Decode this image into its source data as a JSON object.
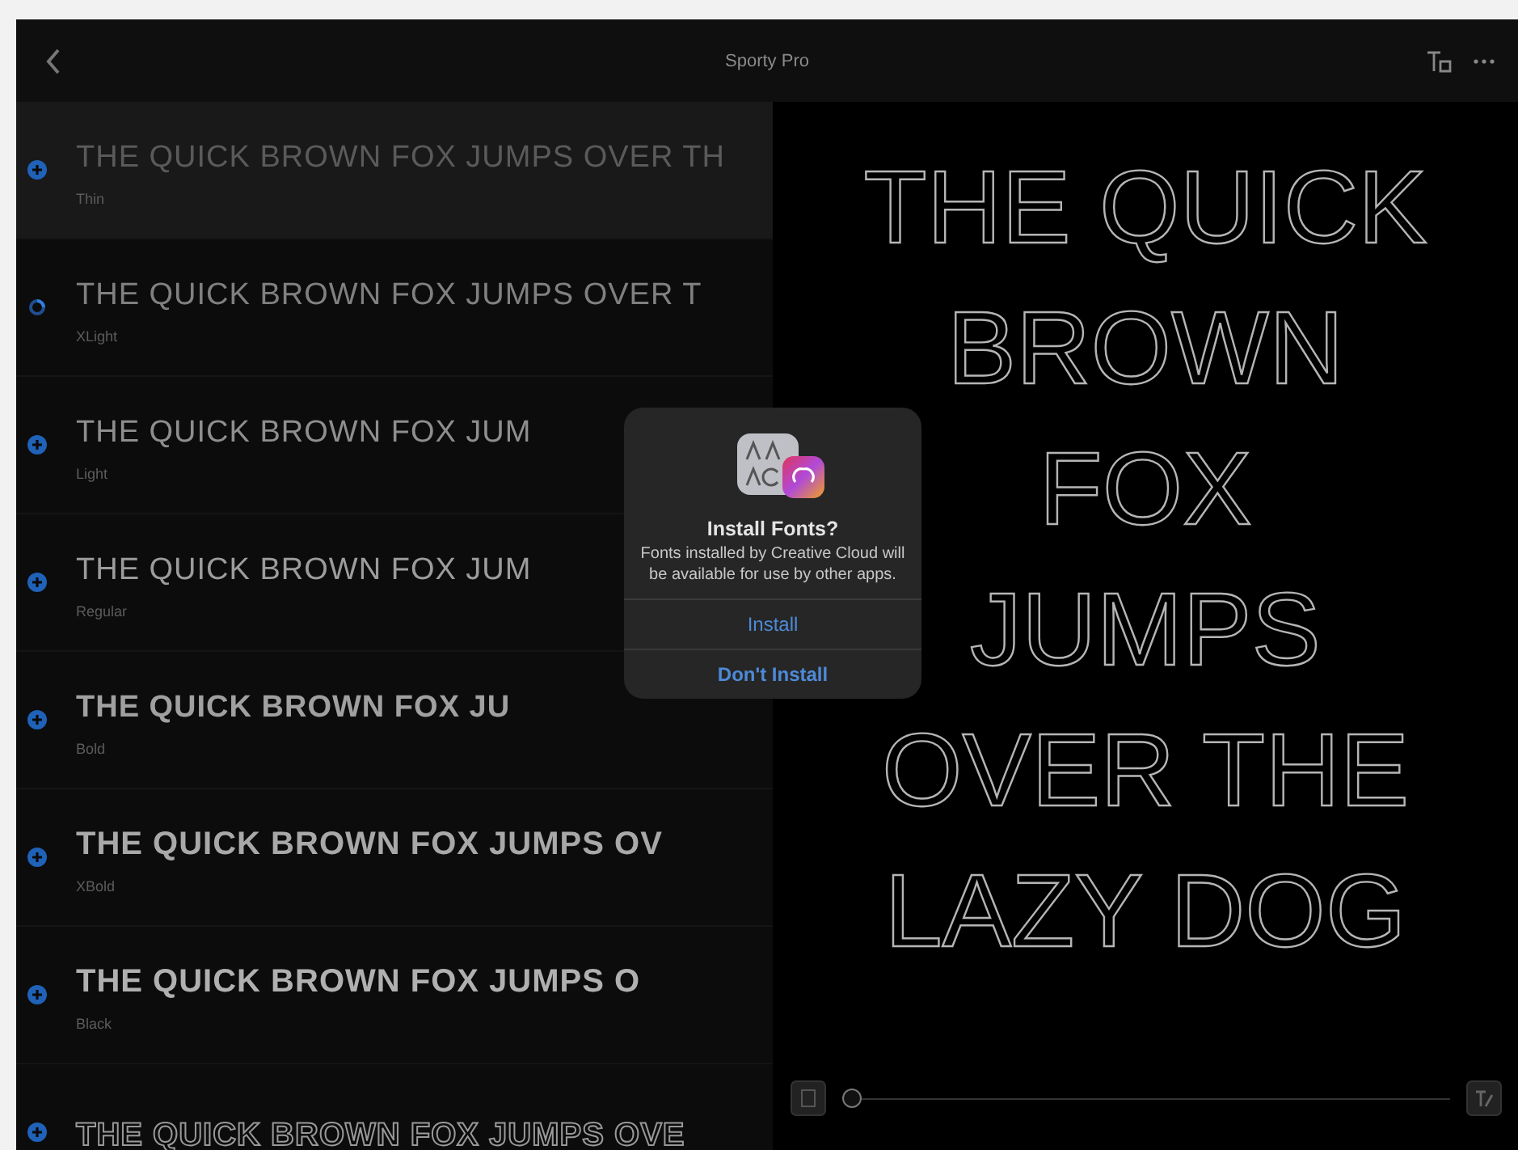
{
  "window": {
    "title": "Sporty Pro"
  },
  "styles": [
    {
      "sample": "THE QUICK BROWN FOX JUMPS OVER TH",
      "name": "Thin",
      "kind": "thin",
      "selected": true,
      "downloading": false
    },
    {
      "sample": "THE QUICK BROWN FOX JUMPS OVER T",
      "name": "XLight",
      "kind": "xlight",
      "selected": false,
      "downloading": true
    },
    {
      "sample": "THE QUICK BROWN FOX JUM",
      "name": "Light",
      "kind": "light",
      "selected": false,
      "downloading": false
    },
    {
      "sample": "THE QUICK BROWN FOX JUM",
      "name": "Regular",
      "kind": "regular",
      "selected": false,
      "downloading": false
    },
    {
      "sample": "THE QUICK BROWN FOX JU",
      "name": "Bold",
      "kind": "bold",
      "selected": false,
      "downloading": false
    },
    {
      "sample": "THE QUICK BROWN FOX JUMPS OV",
      "name": "XBold",
      "kind": "xbold",
      "selected": false,
      "downloading": false
    },
    {
      "sample": "THE QUICK BROWN FOX JUMPS O",
      "name": "Black",
      "kind": "black",
      "selected": false,
      "downloading": false
    },
    {
      "sample": "THE QUICK BROWN FOX JUMPS OVE",
      "kind": "outline",
      "selected": false,
      "downloading": false
    }
  ],
  "preview": {
    "lines": [
      "THE QUICK",
      "BROWN",
      "FOX",
      "JUMPS",
      "OVER THE",
      "LAZY DOG"
    ],
    "size_slider": {
      "level": 0
    }
  },
  "dialog": {
    "title": "Install Fonts?",
    "message": "Fonts installed by Creative Cloud will be available for use by other apps.",
    "buttons": [
      {
        "label": "Install",
        "kind": "normal"
      },
      {
        "label": "Don't Install",
        "kind": "preferred"
      }
    ]
  }
}
